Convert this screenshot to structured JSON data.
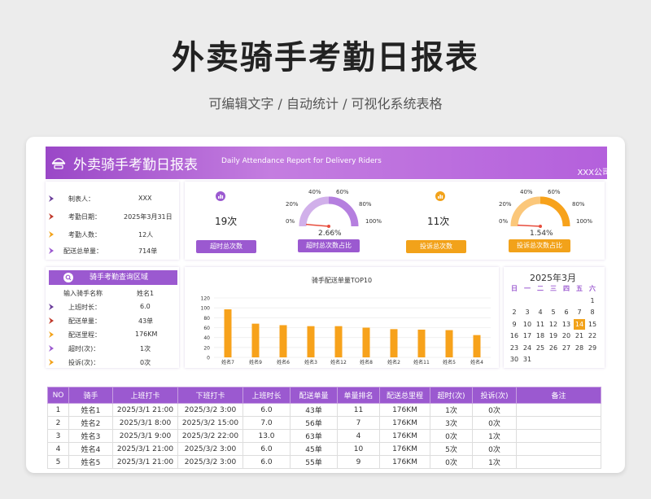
{
  "page": {
    "title": "外卖骑手考勤日报表",
    "subtitle": "可编辑文字 / 自动统计 / 可视化系统表格"
  },
  "banner": {
    "title": "外卖骑手考勤日报表",
    "en_title": "Daily Attendance Report for Delivery Riders",
    "company": "XXX公司"
  },
  "info": [
    {
      "label": "制表人：",
      "value": "XXX"
    },
    {
      "label": "考勤日期：",
      "value": "2025年3月31日"
    },
    {
      "label": "考勤人数：",
      "value": "12人"
    },
    {
      "label": "配送总单量：",
      "value": "714单"
    }
  ],
  "stats": {
    "overtime": {
      "count": "19次",
      "button": "超时总次数",
      "ratio_button": "超时总次数占比",
      "pct": "2.66%",
      "fraction": 0.0266
    },
    "complaint": {
      "count": "11次",
      "button": "投诉总次数",
      "ratio_button": "投诉总次数占比",
      "pct": "1.54%",
      "fraction": 0.0154
    },
    "gauge_ticks": [
      "0%",
      "20%",
      "40%",
      "60%",
      "80%",
      "100%"
    ]
  },
  "query": {
    "header": "骑手考勤查询区域",
    "input_label": "输入骑手名称",
    "input_value": "姓名1",
    "rows": [
      {
        "label": "上班时长：",
        "value": "6.0"
      },
      {
        "label": "配送单量：",
        "value": "43单"
      },
      {
        "label": "配送里程：",
        "value": "176KM"
      },
      {
        "label": "超时(次)：",
        "value": "1次"
      },
      {
        "label": "投诉(次)：",
        "value": "0次"
      }
    ]
  },
  "chart_data": {
    "type": "bar",
    "title": "骑手配送单量TOP10",
    "categories": [
      "姓名7",
      "姓名9",
      "姓名6",
      "姓名3",
      "姓名12",
      "姓名8",
      "姓名2",
      "姓名11",
      "姓名5",
      "姓名4"
    ],
    "values": [
      97,
      68,
      65,
      63,
      63,
      60,
      57,
      56,
      55,
      45
    ],
    "ylim": [
      0,
      120
    ],
    "yticks": [
      "0",
      "20",
      "40",
      "60",
      "80",
      "100",
      "120"
    ],
    "grid": true,
    "color": "#f7a21b"
  },
  "calendar": {
    "title": "2025年3月",
    "weekdays": [
      "日",
      "一",
      "二",
      "三",
      "四",
      "五",
      "六"
    ],
    "weeks": [
      [
        "",
        "",
        "",
        "",
        "",
        "",
        "1"
      ],
      [
        "2",
        "3",
        "4",
        "5",
        "6",
        "7",
        "8"
      ],
      [
        "9",
        "10",
        "11",
        "12",
        "13",
        "14",
        "15"
      ],
      [
        "16",
        "17",
        "18",
        "19",
        "20",
        "21",
        "22"
      ],
      [
        "23",
        "24",
        "25",
        "26",
        "27",
        "28",
        "29"
      ],
      [
        "30",
        "31",
        "",
        "",
        "",
        "",
        ""
      ]
    ],
    "highlight": "14"
  },
  "table": {
    "headers": [
      "NO",
      "骑手",
      "上班打卡",
      "下班打卡",
      "上班时长",
      "配送单量",
      "单量排名",
      "配送总里程",
      "超时(次)",
      "投诉(次)",
      "备注"
    ],
    "rows": [
      [
        "1",
        "姓名1",
        "2025/3/1 21:00",
        "2025/3/2 3:00",
        "6.0",
        "43单",
        "11",
        "176KM",
        "1次",
        "0次",
        ""
      ],
      [
        "2",
        "姓名2",
        "2025/3/1 8:00",
        "2025/3/2 15:00",
        "7.0",
        "56单",
        "7",
        "176KM",
        "3次",
        "0次",
        ""
      ],
      [
        "3",
        "姓名3",
        "2025/3/1 9:00",
        "2025/3/2 22:00",
        "13.0",
        "63单",
        "4",
        "176KM",
        "0次",
        "1次",
        ""
      ],
      [
        "4",
        "姓名4",
        "2025/3/1 21:00",
        "2025/3/2 3:00",
        "6.0",
        "45单",
        "10",
        "176KM",
        "5次",
        "0次",
        ""
      ],
      [
        "5",
        "姓名5",
        "2025/3/1 21:00",
        "2025/3/2 3:00",
        "6.0",
        "55单",
        "9",
        "176KM",
        "0次",
        "1次",
        ""
      ]
    ]
  },
  "colors": {
    "purple": "#9b59d0",
    "orange": "#f2a21a",
    "gauge_purple": "#b57fdf",
    "gauge_orange": "#f7a21b"
  }
}
